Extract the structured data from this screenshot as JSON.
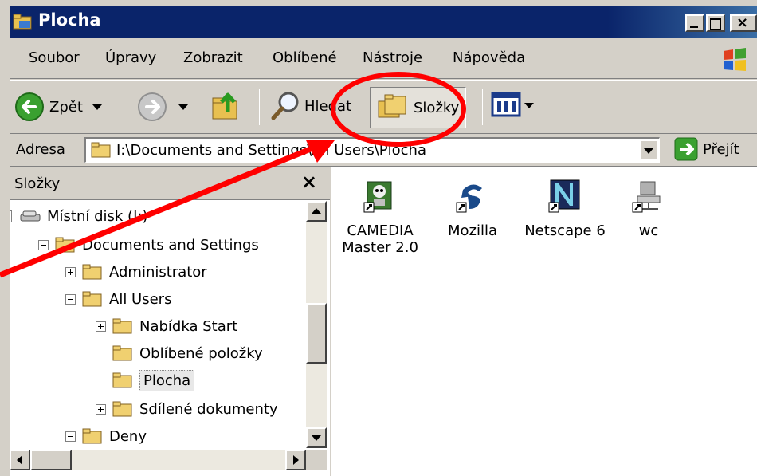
{
  "window": {
    "title": "Plocha"
  },
  "menu": [
    "Soubor",
    "Úpravy",
    "Zobrazit",
    "Oblíbené",
    "Nástroje",
    "Nápověda"
  ],
  "toolbar": {
    "back": "Zpět",
    "search": "Hledat",
    "folders": "Složky"
  },
  "address": {
    "label": "Adresa",
    "value": "I:\\Documents and Settings\\All Users\\Plocha",
    "go": "Přejít"
  },
  "folders_pane": {
    "title": "Složky",
    "close": "×"
  },
  "tree": [
    {
      "label": "Místní disk (I:)"
    },
    {
      "label": "Documents and Settings"
    },
    {
      "label": "Administrator"
    },
    {
      "label": "All Users"
    },
    {
      "label": "Nabídka Start"
    },
    {
      "label": "Oblíbené položky"
    },
    {
      "label": "Plocha"
    },
    {
      "label": "Sdílené dokumenty"
    },
    {
      "label": "Deny"
    }
  ],
  "files": [
    {
      "name": "CAMEDIA Master 2.0",
      "icon": "camedia-shortcut-icon"
    },
    {
      "name": "Mozilla",
      "icon": "mozilla-shortcut-icon"
    },
    {
      "name": "Netscape 6",
      "icon": "netscape-shortcut-icon"
    },
    {
      "name": "wc",
      "icon": "network-computer-shortcut-icon"
    }
  ],
  "annotation": {
    "color": "#ff0000"
  }
}
